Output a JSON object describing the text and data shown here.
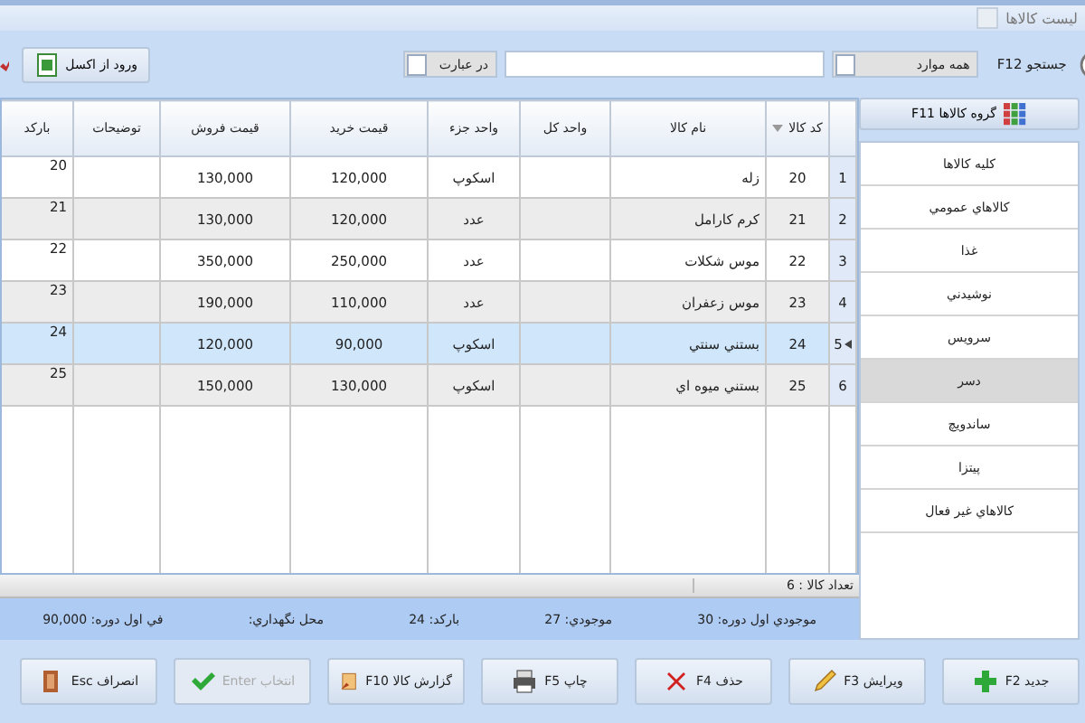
{
  "window": {
    "title": "لیست کالاها"
  },
  "toolbar": {
    "search_label": "جستجو F12",
    "scope": {
      "value": "همه موارد"
    },
    "match": {
      "value": "در عبارت"
    },
    "import_button": "ورود از اکسل"
  },
  "table": {
    "columns": [
      {
        "sorted": false
      },
      {
        "label": "کد کالا",
        "sorted": true
      },
      {
        "label": "نام کالا",
        "sorted": false
      },
      {
        "label": "واحد کل",
        "sorted": false
      },
      {
        "label": "واحد جزء",
        "sorted": false
      },
      {
        "label": "قیمت خرید",
        "sorted": false
      },
      {
        "label": "قیمت فروش",
        "sorted": false
      },
      {
        "label": "توضیحات",
        "sorted": false
      },
      {
        "label": "بارکد",
        "sorted": false
      }
    ],
    "rows": [
      {
        "cells": [
          "1",
          "20",
          "زله",
          "",
          "اسکوپ",
          "120,000",
          "130,000",
          "",
          "20"
        ],
        "selected": false
      },
      {
        "cells": [
          "2",
          "21",
          "کرم کارامل",
          "",
          "عدد",
          "120,000",
          "130,000",
          "",
          "21"
        ],
        "selected": false
      },
      {
        "cells": [
          "3",
          "22",
          "موس شکلات",
          "",
          "عدد",
          "250,000",
          "350,000",
          "",
          "22"
        ],
        "selected": false
      },
      {
        "cells": [
          "4",
          "23",
          "موس زعفران",
          "",
          "عدد",
          "110,000",
          "190,000",
          "",
          "23"
        ],
        "selected": false
      },
      {
        "cells": [
          "5",
          "24",
          "بستني سنتي",
          "",
          "اسکوپ",
          "90,000",
          "120,000",
          "",
          "24"
        ],
        "selected": true
      },
      {
        "cells": [
          "6",
          "25",
          "بستني ميوه اي",
          "",
          "اسکوپ",
          "130,000",
          "150,000",
          "",
          "25"
        ],
        "selected": false
      }
    ],
    "count": "تعداد کالا : 6"
  },
  "details": [
    "موجودي اول دوره: 30",
    "موجودي: 27",
    "بارکد: 24",
    "محل نگهداري:",
    "في اول دوره: 90,000"
  ],
  "sidebar": {
    "title": "گروه کالاها F11",
    "items": [
      {
        "label": "کليه کالاها",
        "selected": false
      },
      {
        "label": "کالاهاي عمومي",
        "selected": false
      },
      {
        "label": "غذا",
        "selected": false
      },
      {
        "label": "نوشيدني",
        "selected": false
      },
      {
        "label": "سرويس",
        "selected": false
      },
      {
        "label": "دسر",
        "selected": true
      },
      {
        "label": "ساندويچ",
        "selected": false
      },
      {
        "label": "پيتزا",
        "selected": false
      },
      {
        "label": "کالاهاي غير فعال",
        "selected": false
      }
    ]
  },
  "buttons": [
    {
      "label": "جديد F2",
      "disabled": false
    },
    {
      "label": "ويرايش F3",
      "disabled": false
    },
    {
      "label": "حذف F4",
      "disabled": false
    },
    {
      "label": "چاپ F5",
      "disabled": false
    },
    {
      "label": "گزارش کالا F10",
      "disabled": false
    },
    {
      "label": "انتخاب Enter",
      "disabled": true
    },
    {
      "label": "انصراف Esc",
      "disabled": false
    }
  ]
}
